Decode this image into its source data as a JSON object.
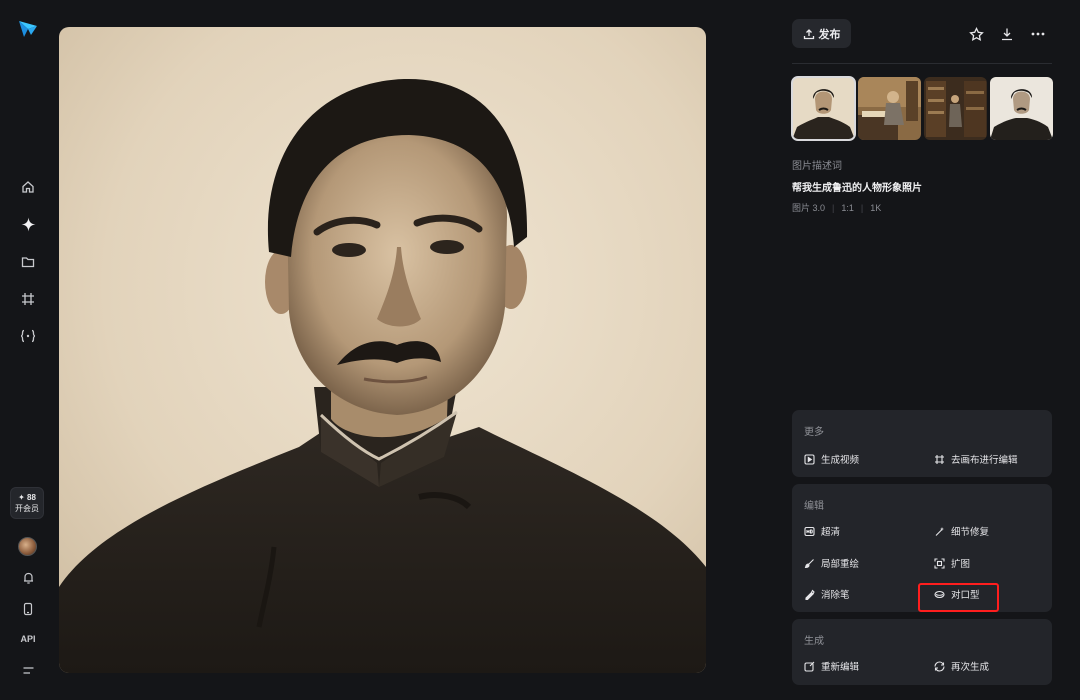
{
  "sidebar": {
    "vip": {
      "count": "✦ 88",
      "label": "开会员"
    },
    "api_label": "API"
  },
  "panel": {
    "publish_label": "发布",
    "description": {
      "title": "图片描述词",
      "prompt": "帮我生成鲁迅的人物形象照片",
      "meta": [
        "图片 3.0",
        "1:1",
        "1K"
      ]
    },
    "more": {
      "title": "更多",
      "actions": [
        "生成视频",
        "去画布进行编辑"
      ]
    },
    "edit": {
      "title": "编辑",
      "actions": [
        "超清",
        "细节修复",
        "局部重绘",
        "扩图",
        "消除笔",
        "对口型"
      ]
    },
    "generate": {
      "title": "生成",
      "actions": [
        "重新编辑",
        "再次生成"
      ]
    }
  },
  "colors": {
    "background": "#141518",
    "card": "#23252a",
    "highlight": "#ff1e1e",
    "accent_logo": "#2bb6f5"
  }
}
